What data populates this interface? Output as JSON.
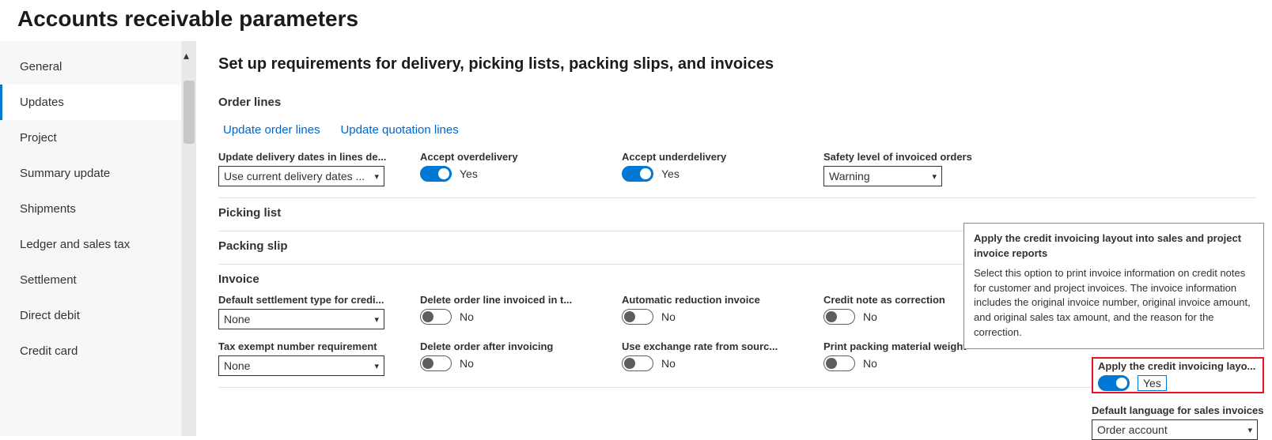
{
  "page_title": "Accounts receivable parameters",
  "sidebar": {
    "items": [
      {
        "label": "General"
      },
      {
        "label": "Updates"
      },
      {
        "label": "Project"
      },
      {
        "label": "Summary update"
      },
      {
        "label": "Shipments"
      },
      {
        "label": "Ledger and sales tax"
      },
      {
        "label": "Settlement"
      },
      {
        "label": "Direct debit"
      },
      {
        "label": "Credit card"
      }
    ],
    "active_index": 1
  },
  "main": {
    "section_title": "Set up requirements for delivery, picking lists, packing slips, and invoices",
    "order_lines": {
      "title": "Order lines",
      "link1": "Update order lines",
      "link2": "Update quotation lines",
      "update_delivery_dates_label": "Update delivery dates in lines de...",
      "update_delivery_dates_value": "Use current delivery dates ...",
      "accept_overdelivery_label": "Accept overdelivery",
      "accept_overdelivery_value": "Yes",
      "accept_underdelivery_label": "Accept underdelivery",
      "accept_underdelivery_value": "Yes",
      "safety_level_label": "Safety level of invoiced orders",
      "safety_level_value": "Warning"
    },
    "picking_list_title": "Picking list",
    "packing_slip_title": "Packing slip",
    "invoice": {
      "title": "Invoice",
      "default_settlement_label": "Default settlement type for credi...",
      "default_settlement_value": "None",
      "delete_order_line_label": "Delete order line invoiced in t...",
      "delete_order_line_value": "No",
      "automatic_reduction_label": "Automatic reduction invoice",
      "automatic_reduction_value": "No",
      "credit_note_correction_label": "Credit note as correction",
      "credit_note_correction_value": "No",
      "tax_exempt_label": "Tax exempt number requirement",
      "tax_exempt_value": "None",
      "delete_order_after_label": "Delete order after invoicing",
      "delete_order_after_value": "No",
      "use_exchange_label": "Use exchange rate from sourc...",
      "use_exchange_value": "No",
      "print_packing_label": "Print packing material weight",
      "print_packing_value": "No",
      "apply_credit_label": "Apply the credit invoicing layo...",
      "apply_credit_value": "Yes",
      "default_language_label": "Default language for sales invoices",
      "default_language_value": "Order account"
    }
  },
  "tooltip": {
    "title": "Apply the credit invoicing layout into sales and project invoice reports",
    "body": "Select this option to print invoice information on credit notes for customer and project invoices. The invoice information includes the original invoice number, original invoice amount, and original sales tax amount, and the reason for the correction."
  }
}
